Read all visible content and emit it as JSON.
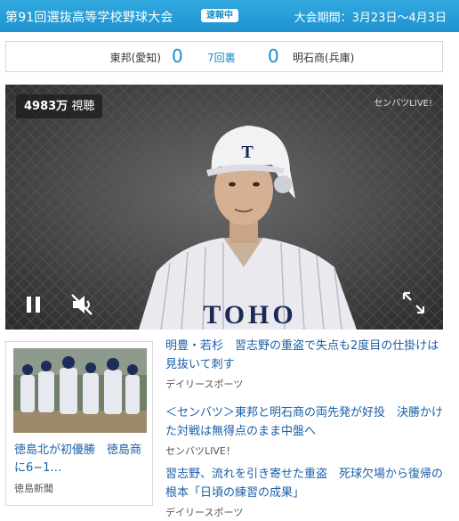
{
  "header": {
    "title": "第91回選抜高等学校野球大会",
    "badge": "速報中",
    "period": "大会期間：3月23日〜4月3日"
  },
  "score": {
    "home_team": "東邦(愛知)",
    "home_score": "0",
    "inning": "7回裏",
    "away_score": "0",
    "away_team": "明石商(兵庫)"
  },
  "video": {
    "viewers_count": "4983万",
    "viewers_label": "視聴",
    "watermark": "センバツLIVE!",
    "helmet_letter": "T",
    "jersey_text": "TOHO",
    "controls": [
      "pause-icon",
      "mute-icon",
      "fullscreen-icon"
    ]
  },
  "news_card": {
    "headline": "徳島北が初優勝　徳島商に6−1…",
    "source": "徳島新聞"
  },
  "news_list": [
    {
      "headline": "明豊・若杉　習志野の重盗で失点も2度目の仕掛けは見抜いて刺す",
      "source": "デイリースポーツ"
    },
    {
      "headline": "＜センバツ＞東邦と明石商の両先発が好投　決勝かけた対戦は無得点のまま中盤へ",
      "source": "センバツLIVE！"
    },
    {
      "headline": "習志野、流れを引き寄せた重盗　死球欠場から復帰の根本「日頃の練習の成果」",
      "source": "デイリースポーツ"
    }
  ],
  "colors": {
    "header_bg": "#1e93cf",
    "accent": "#1a8cc8",
    "link": "#1a5fa8"
  }
}
